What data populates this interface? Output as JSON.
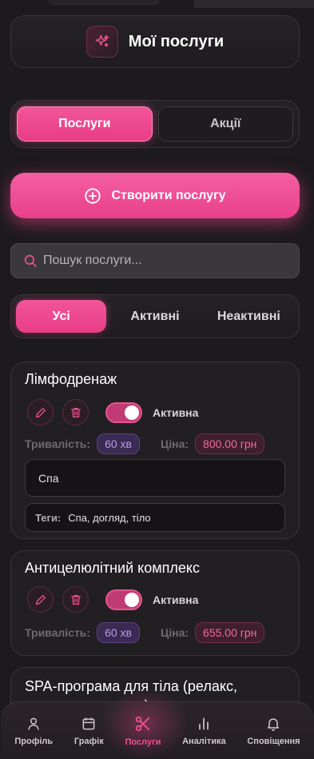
{
  "header": {
    "title": "Мої послуги",
    "icon": "sparkles-icon"
  },
  "tabs": [
    {
      "label": "Послуги",
      "active": true
    },
    {
      "label": "Акції",
      "active": false
    }
  ],
  "create_button": {
    "label": "Створити послугу",
    "icon": "plus-circle-icon"
  },
  "search": {
    "placeholder": "Пошук послуги...",
    "value": ""
  },
  "filters": [
    {
      "label": "Усі",
      "active": true
    },
    {
      "label": "Активні",
      "active": false
    },
    {
      "label": "Неактивні",
      "active": false
    }
  ],
  "labels": {
    "duration": "Тривалість:",
    "price": "Ціна:",
    "tags": "Теги:"
  },
  "services": [
    {
      "title": "Лімфодренаж",
      "status": "Активна",
      "active": true,
      "duration": "60 хв",
      "price": "800.00 грн",
      "category": "Спа",
      "tags": "Спа, догляд, тіло"
    },
    {
      "title": "Антицелюлітний комплекс",
      "status": "Активна",
      "active": true,
      "duration": "60 хв",
      "price": "655.00 грн"
    },
    {
      "title": "SPA-програма для тіла (релакс, антистрес, детокс)"
    }
  ],
  "bottom_nav": [
    {
      "label": "Профіль",
      "icon": "user-icon",
      "active": false
    },
    {
      "label": "Графік",
      "icon": "calendar-icon",
      "active": false
    },
    {
      "label": "Послуги",
      "icon": "scissors-icon",
      "active": true
    },
    {
      "label": "Аналітика",
      "icon": "bar-chart-icon",
      "active": false
    },
    {
      "label": "Сповіщення",
      "icon": "bell-icon",
      "active": false
    }
  ],
  "colors": {
    "accent": "#f0508f",
    "background": "#1c1a1d",
    "purple_badge": "#b99be4"
  }
}
